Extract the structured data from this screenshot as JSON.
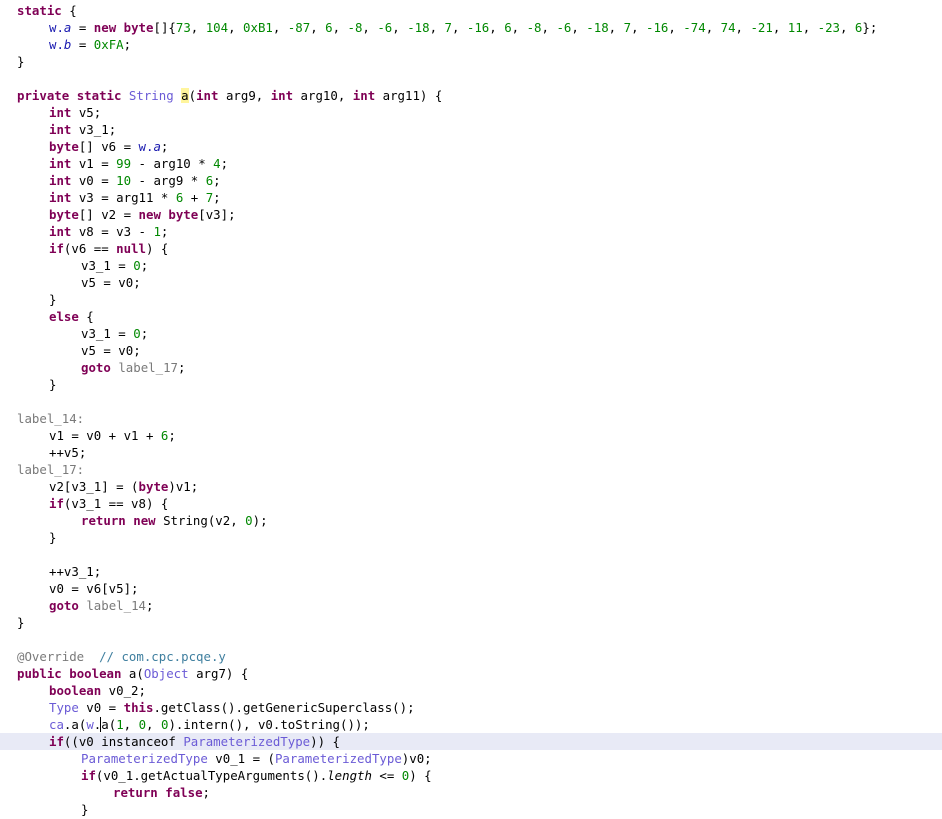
{
  "colors": {
    "keyword": "#7f0055",
    "number": "#008800",
    "field": "#1a1ab0",
    "class_reference": "#6b5bd6",
    "label": "#7a7a7a",
    "comment": "#3f7f9f",
    "current_line_highlight": "#e8eaf6",
    "occurrence_highlight": "#fff59d"
  },
  "editor": {
    "cursor_line": 43,
    "lines": [
      {
        "indent": 0,
        "tokens": [
          {
            "k": "kw",
            "t": "static"
          },
          {
            "k": "p",
            "t": " {"
          }
        ]
      },
      {
        "indent": 1,
        "tokens": [
          {
            "k": "field",
            "t": "w."
          },
          {
            "k": "field-i",
            "t": "a"
          },
          {
            "k": "p",
            "t": " = "
          },
          {
            "k": "kw",
            "t": "new"
          },
          {
            "k": "p",
            "t": " "
          },
          {
            "k": "kw",
            "t": "byte"
          },
          {
            "k": "p",
            "t": "[]{"
          },
          {
            "k": "num",
            "t": "73"
          },
          {
            "k": "p",
            "t": ", "
          },
          {
            "k": "num",
            "t": "104"
          },
          {
            "k": "p",
            "t": ", "
          },
          {
            "k": "num",
            "t": "0xB1"
          },
          {
            "k": "p",
            "t": ", "
          },
          {
            "k": "num",
            "t": "-87"
          },
          {
            "k": "p",
            "t": ", "
          },
          {
            "k": "num",
            "t": "6"
          },
          {
            "k": "p",
            "t": ", "
          },
          {
            "k": "num",
            "t": "-8"
          },
          {
            "k": "p",
            "t": ", "
          },
          {
            "k": "num",
            "t": "-6"
          },
          {
            "k": "p",
            "t": ", "
          },
          {
            "k": "num",
            "t": "-18"
          },
          {
            "k": "p",
            "t": ", "
          },
          {
            "k": "num",
            "t": "7"
          },
          {
            "k": "p",
            "t": ", "
          },
          {
            "k": "num",
            "t": "-16"
          },
          {
            "k": "p",
            "t": ", "
          },
          {
            "k": "num",
            "t": "6"
          },
          {
            "k": "p",
            "t": ", "
          },
          {
            "k": "num",
            "t": "-8"
          },
          {
            "k": "p",
            "t": ", "
          },
          {
            "k": "num",
            "t": "-6"
          },
          {
            "k": "p",
            "t": ", "
          },
          {
            "k": "num",
            "t": "-18"
          },
          {
            "k": "p",
            "t": ", "
          },
          {
            "k": "num",
            "t": "7"
          },
          {
            "k": "p",
            "t": ", "
          },
          {
            "k": "num",
            "t": "-16"
          },
          {
            "k": "p",
            "t": ", "
          },
          {
            "k": "num",
            "t": "-74"
          },
          {
            "k": "p",
            "t": ", "
          },
          {
            "k": "num",
            "t": "74"
          },
          {
            "k": "p",
            "t": ", "
          },
          {
            "k": "num",
            "t": "-21"
          },
          {
            "k": "p",
            "t": ", "
          },
          {
            "k": "num",
            "t": "11"
          },
          {
            "k": "p",
            "t": ", "
          },
          {
            "k": "num",
            "t": "-23"
          },
          {
            "k": "p",
            "t": ", "
          },
          {
            "k": "num",
            "t": "6"
          },
          {
            "k": "p",
            "t": "};"
          }
        ]
      },
      {
        "indent": 1,
        "tokens": [
          {
            "k": "field",
            "t": "w."
          },
          {
            "k": "field-i",
            "t": "b"
          },
          {
            "k": "p",
            "t": " = "
          },
          {
            "k": "num",
            "t": "0xFA"
          },
          {
            "k": "p",
            "t": ";"
          }
        ]
      },
      {
        "indent": 0,
        "tokens": [
          {
            "k": "p",
            "t": "}"
          }
        ]
      },
      {
        "indent": 0,
        "tokens": []
      },
      {
        "indent": 0,
        "tokens": [
          {
            "k": "kw",
            "t": "private"
          },
          {
            "k": "p",
            "t": " "
          },
          {
            "k": "kw",
            "t": "static"
          },
          {
            "k": "p",
            "t": " "
          },
          {
            "k": "cls",
            "t": "String"
          },
          {
            "k": "p",
            "t": " "
          },
          {
            "k": "hl",
            "t": "a"
          },
          {
            "k": "p",
            "t": "("
          },
          {
            "k": "kw",
            "t": "int"
          },
          {
            "k": "p",
            "t": " arg9, "
          },
          {
            "k": "kw",
            "t": "int"
          },
          {
            "k": "p",
            "t": " arg10, "
          },
          {
            "k": "kw",
            "t": "int"
          },
          {
            "k": "p",
            "t": " arg11) {"
          }
        ]
      },
      {
        "indent": 1,
        "tokens": [
          {
            "k": "kw",
            "t": "int"
          },
          {
            "k": "p",
            "t": " v5;"
          }
        ]
      },
      {
        "indent": 1,
        "tokens": [
          {
            "k": "kw",
            "t": "int"
          },
          {
            "k": "p",
            "t": " v3_1;"
          }
        ]
      },
      {
        "indent": 1,
        "tokens": [
          {
            "k": "kw",
            "t": "byte"
          },
          {
            "k": "p",
            "t": "[] v6 = "
          },
          {
            "k": "field",
            "t": "w."
          },
          {
            "k": "field-i",
            "t": "a"
          },
          {
            "k": "p",
            "t": ";"
          }
        ]
      },
      {
        "indent": 1,
        "tokens": [
          {
            "k": "kw",
            "t": "int"
          },
          {
            "k": "p",
            "t": " v1 = "
          },
          {
            "k": "num",
            "t": "99"
          },
          {
            "k": "p",
            "t": " - arg10 * "
          },
          {
            "k": "num",
            "t": "4"
          },
          {
            "k": "p",
            "t": ";"
          }
        ]
      },
      {
        "indent": 1,
        "tokens": [
          {
            "k": "kw",
            "t": "int"
          },
          {
            "k": "p",
            "t": " v0 = "
          },
          {
            "k": "num",
            "t": "10"
          },
          {
            "k": "p",
            "t": " - arg9 * "
          },
          {
            "k": "num",
            "t": "6"
          },
          {
            "k": "p",
            "t": ";"
          }
        ]
      },
      {
        "indent": 1,
        "tokens": [
          {
            "k": "kw",
            "t": "int"
          },
          {
            "k": "p",
            "t": " v3 = arg11 * "
          },
          {
            "k": "num",
            "t": "6"
          },
          {
            "k": "p",
            "t": " + "
          },
          {
            "k": "num",
            "t": "7"
          },
          {
            "k": "p",
            "t": ";"
          }
        ]
      },
      {
        "indent": 1,
        "tokens": [
          {
            "k": "kw",
            "t": "byte"
          },
          {
            "k": "p",
            "t": "[] v2 = "
          },
          {
            "k": "kw",
            "t": "new"
          },
          {
            "k": "p",
            "t": " "
          },
          {
            "k": "kw",
            "t": "byte"
          },
          {
            "k": "p",
            "t": "[v3];"
          }
        ]
      },
      {
        "indent": 1,
        "tokens": [
          {
            "k": "kw",
            "t": "int"
          },
          {
            "k": "p",
            "t": " v8 = v3 - "
          },
          {
            "k": "num",
            "t": "1"
          },
          {
            "k": "p",
            "t": ";"
          }
        ]
      },
      {
        "indent": 1,
        "tokens": [
          {
            "k": "kw",
            "t": "if"
          },
          {
            "k": "p",
            "t": "(v6 == "
          },
          {
            "k": "kw",
            "t": "null"
          },
          {
            "k": "p",
            "t": ") {"
          }
        ]
      },
      {
        "indent": 2,
        "tokens": [
          {
            "k": "p",
            "t": "v3_1 = "
          },
          {
            "k": "num",
            "t": "0"
          },
          {
            "k": "p",
            "t": ";"
          }
        ]
      },
      {
        "indent": 2,
        "tokens": [
          {
            "k": "p",
            "t": "v5 = v0;"
          }
        ]
      },
      {
        "indent": 1,
        "tokens": [
          {
            "k": "p",
            "t": "}"
          }
        ]
      },
      {
        "indent": 1,
        "tokens": [
          {
            "k": "kw",
            "t": "else"
          },
          {
            "k": "p",
            "t": " {"
          }
        ]
      },
      {
        "indent": 2,
        "tokens": [
          {
            "k": "p",
            "t": "v3_1 = "
          },
          {
            "k": "num",
            "t": "0"
          },
          {
            "k": "p",
            "t": ";"
          }
        ]
      },
      {
        "indent": 2,
        "tokens": [
          {
            "k": "p",
            "t": "v5 = v0;"
          }
        ]
      },
      {
        "indent": 2,
        "tokens": [
          {
            "k": "kw",
            "t": "goto"
          },
          {
            "k": "p",
            "t": " "
          },
          {
            "k": "label",
            "t": "label_17"
          },
          {
            "k": "p",
            "t": ";"
          }
        ]
      },
      {
        "indent": 1,
        "tokens": [
          {
            "k": "p",
            "t": "}"
          }
        ]
      },
      {
        "indent": 0,
        "tokens": []
      },
      {
        "indent": 0,
        "tokens": [
          {
            "k": "label",
            "t": "label_14:"
          }
        ]
      },
      {
        "indent": 1,
        "tokens": [
          {
            "k": "p",
            "t": "v1 = v0 + v1 + "
          },
          {
            "k": "num",
            "t": "6"
          },
          {
            "k": "p",
            "t": ";"
          }
        ]
      },
      {
        "indent": 1,
        "tokens": [
          {
            "k": "p",
            "t": "++v5;"
          }
        ]
      },
      {
        "indent": 0,
        "tokens": [
          {
            "k": "label",
            "t": "label_17:"
          }
        ]
      },
      {
        "indent": 1,
        "tokens": [
          {
            "k": "p",
            "t": "v2[v3_1] = ("
          },
          {
            "k": "kw",
            "t": "byte"
          },
          {
            "k": "p",
            "t": ")v1;"
          }
        ]
      },
      {
        "indent": 1,
        "tokens": [
          {
            "k": "kw",
            "t": "if"
          },
          {
            "k": "p",
            "t": "(v3_1 == v8) {"
          }
        ]
      },
      {
        "indent": 2,
        "tokens": [
          {
            "k": "kw",
            "t": "return"
          },
          {
            "k": "p",
            "t": " "
          },
          {
            "k": "kw",
            "t": "new"
          },
          {
            "k": "p",
            "t": " String(v2, "
          },
          {
            "k": "num",
            "t": "0"
          },
          {
            "k": "p",
            "t": ");"
          }
        ]
      },
      {
        "indent": 1,
        "tokens": [
          {
            "k": "p",
            "t": "}"
          }
        ]
      },
      {
        "indent": 0,
        "tokens": []
      },
      {
        "indent": 1,
        "tokens": [
          {
            "k": "p",
            "t": "++v3_1;"
          }
        ]
      },
      {
        "indent": 1,
        "tokens": [
          {
            "k": "p",
            "t": "v0 = v6[v5];"
          }
        ]
      },
      {
        "indent": 1,
        "tokens": [
          {
            "k": "kw",
            "t": "goto"
          },
          {
            "k": "p",
            "t": " "
          },
          {
            "k": "label",
            "t": "label_14"
          },
          {
            "k": "p",
            "t": ";"
          }
        ]
      },
      {
        "indent": 0,
        "tokens": [
          {
            "k": "p",
            "t": "}"
          }
        ]
      },
      {
        "indent": 0,
        "tokens": []
      },
      {
        "indent": 0,
        "tokens": [
          {
            "k": "anno",
            "t": "@Override"
          },
          {
            "k": "p",
            "t": "  "
          },
          {
            "k": "cmt",
            "t": "// com.cpc.pcqe.y"
          }
        ]
      },
      {
        "indent": 0,
        "tokens": [
          {
            "k": "kw",
            "t": "public"
          },
          {
            "k": "p",
            "t": " "
          },
          {
            "k": "kw",
            "t": "boolean"
          },
          {
            "k": "p",
            "t": " a("
          },
          {
            "k": "cls",
            "t": "Object"
          },
          {
            "k": "p",
            "t": " arg7) {"
          }
        ]
      },
      {
        "indent": 1,
        "tokens": [
          {
            "k": "kw",
            "t": "boolean"
          },
          {
            "k": "p",
            "t": " v0_2;"
          }
        ]
      },
      {
        "indent": 1,
        "tokens": [
          {
            "k": "cls",
            "t": "Type"
          },
          {
            "k": "p",
            "t": " v0 = "
          },
          {
            "k": "kw",
            "t": "this"
          },
          {
            "k": "p",
            "t": ".getClass().getGenericSuperclass();"
          }
        ]
      },
      {
        "indent": 1,
        "tokens": [
          {
            "k": "cls",
            "t": "ca"
          },
          {
            "k": "p",
            "t": ".a("
          },
          {
            "k": "cls",
            "t": "w"
          },
          {
            "k": "p",
            "t": "."
          },
          {
            "k": "caret",
            "t": "a"
          },
          {
            "k": "p",
            "t": "("
          },
          {
            "k": "num",
            "t": "1"
          },
          {
            "k": "p",
            "t": ", "
          },
          {
            "k": "num",
            "t": "0"
          },
          {
            "k": "p",
            "t": ", "
          },
          {
            "k": "num",
            "t": "0"
          },
          {
            "k": "p",
            "t": ").intern(), v0.toString());"
          }
        ]
      },
      {
        "indent": 1,
        "tokens": [
          {
            "k": "kw",
            "t": "if"
          },
          {
            "k": "p",
            "t": "((v0 "
          },
          {
            "k": "p",
            "t": "instanceof"
          },
          {
            "k": "p",
            "t": " "
          },
          {
            "k": "cls",
            "t": "ParameterizedType"
          },
          {
            "k": "p",
            "t": ")) {"
          }
        ]
      },
      {
        "indent": 2,
        "tokens": [
          {
            "k": "cls",
            "t": "ParameterizedType"
          },
          {
            "k": "p",
            "t": " v0_1 = ("
          },
          {
            "k": "cls",
            "t": "ParameterizedType"
          },
          {
            "k": "p",
            "t": ")v0;"
          }
        ]
      },
      {
        "indent": 2,
        "tokens": [
          {
            "k": "kw",
            "t": "if"
          },
          {
            "k": "p",
            "t": "(v0_1.getActualTypeArguments()."
          },
          {
            "k": "ital",
            "t": "length"
          },
          {
            "k": "p",
            "t": " <= "
          },
          {
            "k": "num",
            "t": "0"
          },
          {
            "k": "p",
            "t": ") {"
          }
        ]
      },
      {
        "indent": 3,
        "tokens": [
          {
            "k": "kw",
            "t": "return"
          },
          {
            "k": "p",
            "t": " "
          },
          {
            "k": "kw",
            "t": "false"
          },
          {
            "k": "p",
            "t": ";"
          }
        ]
      },
      {
        "indent": 2,
        "tokens": [
          {
            "k": "p",
            "t": "}"
          }
        ]
      }
    ]
  }
}
